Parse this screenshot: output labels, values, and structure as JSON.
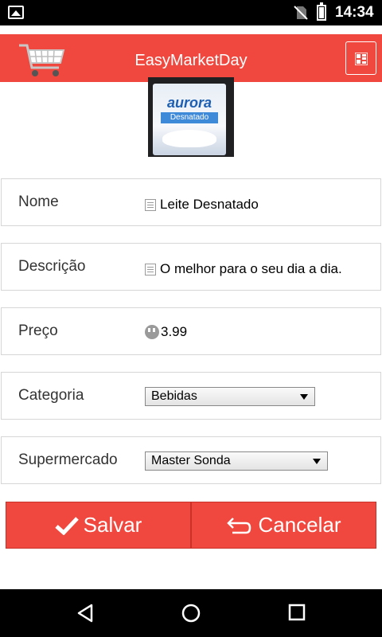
{
  "status_bar": {
    "time": "14:34",
    "icons": [
      "gallery-icon",
      "no-sim-icon",
      "battery-icon"
    ]
  },
  "app_bar": {
    "title": "EasyMarketDay",
    "icons": [
      "cart-icon",
      "grid-menu-icon"
    ]
  },
  "product": {
    "image_brand": "aurora",
    "image_label": "Desnatado"
  },
  "form": {
    "name": {
      "label": "Nome",
      "value": "Leite Desnatado"
    },
    "description": {
      "label": "Descrição",
      "value": "O melhor para o seu dia a dia."
    },
    "price": {
      "label": "Preço",
      "value": "3.99"
    },
    "category": {
      "label": "Categoria",
      "selected": "Bebidas"
    },
    "supermarket": {
      "label": "Supermercado",
      "selected": "Master Sonda"
    }
  },
  "actions": {
    "save_label": "Salvar",
    "cancel_label": "Cancelar"
  },
  "colors": {
    "accent": "#f0483e"
  }
}
